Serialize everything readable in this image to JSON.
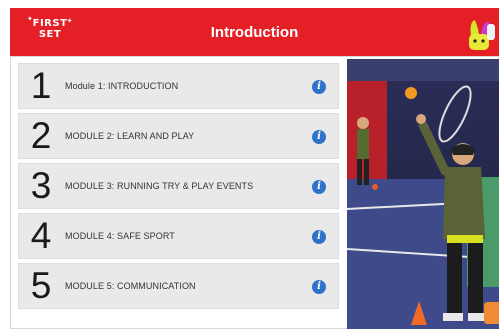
{
  "header": {
    "logo_line1": "FIRST",
    "logo_line2": "SET",
    "title": "Introduction"
  },
  "modules": [
    {
      "number": "1",
      "label": "Module 1: INTRODUCTION"
    },
    {
      "number": "2",
      "label": "MODULE 2: LEARN AND PLAY"
    },
    {
      "number": "3",
      "label": "MODULE 3: RUNNING TRY & PLAY EVENTS"
    },
    {
      "number": "4",
      "label": "MODULE 4: SAFE SPORT"
    },
    {
      "number": "5",
      "label": "MODULE 5: COMMUNICATION"
    }
  ],
  "info_icon": "info-icon",
  "colors": {
    "header_red": "#e41f26",
    "row_gray": "#e9e9e9",
    "info_blue": "#2f72c9",
    "accent_orange": "#f08a35"
  }
}
